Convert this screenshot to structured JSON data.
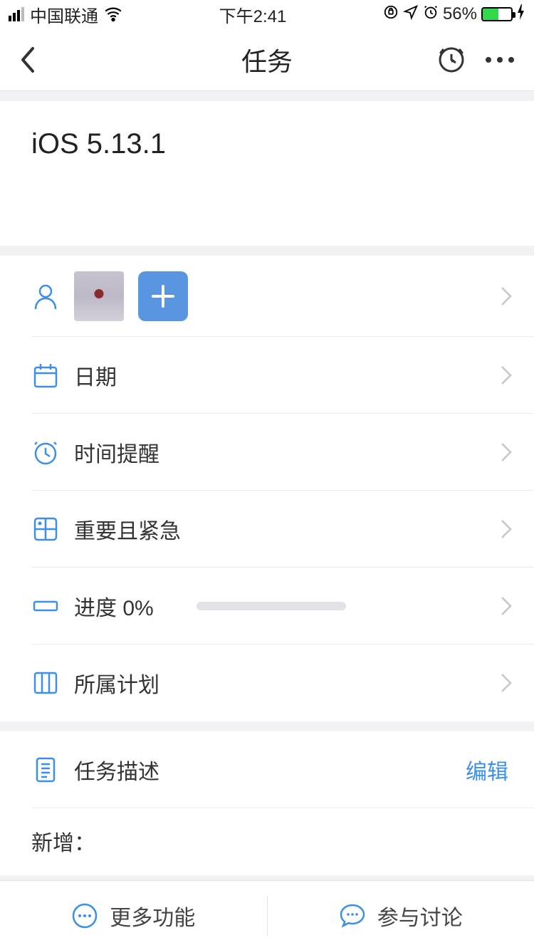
{
  "status": {
    "carrier": "中国联通",
    "time": "下午2:41",
    "battery_pct": "56%"
  },
  "nav": {
    "title": "任务"
  },
  "task": {
    "title": "iOS 5.13.1"
  },
  "rows": {
    "date_label": "日期",
    "reminder_label": "时间提醒",
    "priority_label": "重要且紧急",
    "progress_label": "进度 0%",
    "progress_value": 0,
    "plan_label": "所属计划",
    "description_label": "任务描述",
    "edit_label": "编辑"
  },
  "description_body": "新增：",
  "bottom": {
    "more_label": "更多功能",
    "discuss_label": "参与讨论"
  },
  "colors": {
    "accent": "#3c8fe9"
  }
}
